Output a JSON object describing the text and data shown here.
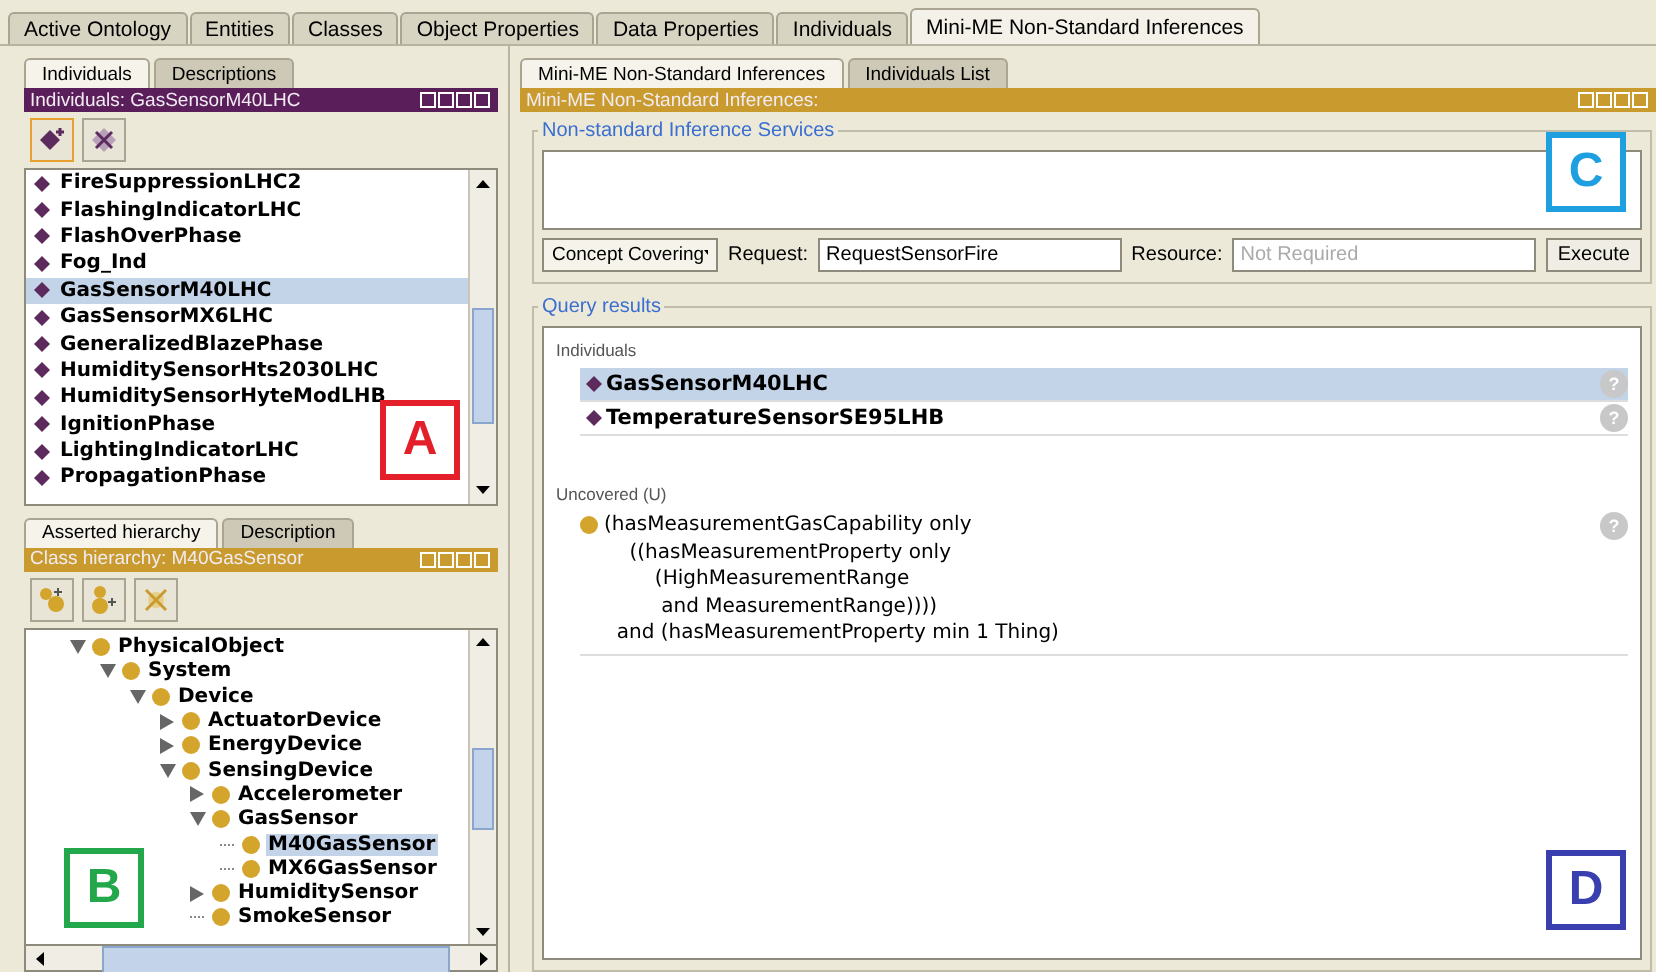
{
  "main_tabs": [
    {
      "label": "Active Ontology",
      "selected": false
    },
    {
      "label": "Entities",
      "selected": false
    },
    {
      "label": "Classes",
      "selected": false
    },
    {
      "label": "Object Properties",
      "selected": false
    },
    {
      "label": "Data Properties",
      "selected": false
    },
    {
      "label": "Individuals",
      "selected": false
    },
    {
      "label": "Mini-ME Non-Standard Inferences",
      "selected": true
    }
  ],
  "individuals_panel": {
    "tabs": [
      {
        "label": "Individuals",
        "selected": true
      },
      {
        "label": "Descriptions",
        "selected": false
      }
    ],
    "title": "Individuals: GasSensorM40LHC",
    "items": [
      {
        "label": "FireSuppressionLHC2",
        "selected": false
      },
      {
        "label": "FlashingIndicatorLHC",
        "selected": false
      },
      {
        "label": "FlashOverPhase",
        "selected": false
      },
      {
        "label": "Fog_Ind",
        "selected": false
      },
      {
        "label": "GasSensorM40LHC",
        "selected": true
      },
      {
        "label": "GasSensorMX6LHC",
        "selected": false
      },
      {
        "label": "GeneralizedBlazePhase",
        "selected": false
      },
      {
        "label": "HumiditySensorHts2030LHC",
        "selected": false
      },
      {
        "label": "HumiditySensorHyteModLHB",
        "selected": false
      },
      {
        "label": "IgnitionPhase",
        "selected": false
      },
      {
        "label": "LightingIndicatorLHC",
        "selected": false
      },
      {
        "label": "PropagationPhase",
        "selected": false
      }
    ]
  },
  "class_panel": {
    "tabs": [
      {
        "label": "Asserted hierarchy",
        "selected": true
      },
      {
        "label": "Description",
        "selected": false
      }
    ],
    "title": "Class hierarchy: M40GasSensor",
    "tree": [
      {
        "label": "PhysicalObject",
        "kind": "expanded",
        "selected": false,
        "children": [
          {
            "label": "System",
            "kind": "expanded",
            "selected": false,
            "children": [
              {
                "label": "Device",
                "kind": "expanded",
                "selected": false,
                "children": [
                  {
                    "label": "ActuatorDevice",
                    "kind": "collapsed",
                    "selected": false
                  },
                  {
                    "label": "EnergyDevice",
                    "kind": "collapsed",
                    "selected": false
                  },
                  {
                    "label": "SensingDevice",
                    "kind": "expanded",
                    "selected": false,
                    "children": [
                      {
                        "label": "Accelerometer",
                        "kind": "collapsed",
                        "selected": false
                      },
                      {
                        "label": "GasSensor",
                        "kind": "expanded",
                        "selected": false,
                        "children": [
                          {
                            "label": "M40GasSensor",
                            "kind": "leaf",
                            "selected": true
                          },
                          {
                            "label": "MX6GasSensor",
                            "kind": "leaf",
                            "selected": false
                          }
                        ]
                      },
                      {
                        "label": "HumiditySensor",
                        "kind": "collapsed",
                        "selected": false
                      },
                      {
                        "label": "SmokeSensor",
                        "kind": "leaf",
                        "selected": false
                      }
                    ]
                  }
                ]
              }
            ]
          }
        ]
      }
    ]
  },
  "inference_panel": {
    "tabs": [
      {
        "label": "Mini-ME Non-Standard Inferences",
        "selected": true
      },
      {
        "label": "Individuals List",
        "selected": false
      }
    ],
    "title": "Mini-ME Non-Standard Inferences:",
    "services": {
      "legend": "Non-standard Inference Services",
      "service": "Concept Covering",
      "request_label": "Request:",
      "request_value": "RequestSensorFire",
      "resource_label": "Resource:",
      "resource_placeholder": "Not Required",
      "execute": "Execute"
    },
    "results": {
      "legend": "Query results",
      "individuals_heading": "Individuals",
      "individuals": [
        {
          "label": "GasSensorM40LHC",
          "selected": true,
          "hint": "?"
        },
        {
          "label": "TemperatureSensorSE95LHB",
          "selected": false,
          "hint": "?"
        }
      ],
      "uncovered_heading": "Uncovered (U)",
      "uncovered": [
        {
          "expression": "(hasMeasurementGasCapability only\n    ((hasMeasurementProperty only\n        (HighMeasurementRange\n         and MeasurementRange))))\n  and (hasMeasurementProperty min 1 Thing)",
          "hint": "?"
        }
      ]
    }
  },
  "callouts": [
    {
      "label": "A",
      "color": "#e3202a"
    },
    {
      "label": "B",
      "color": "#22a84a"
    },
    {
      "label": "C",
      "color": "#1ea0e0"
    },
    {
      "label": "D",
      "color": "#3a3fb0"
    }
  ]
}
